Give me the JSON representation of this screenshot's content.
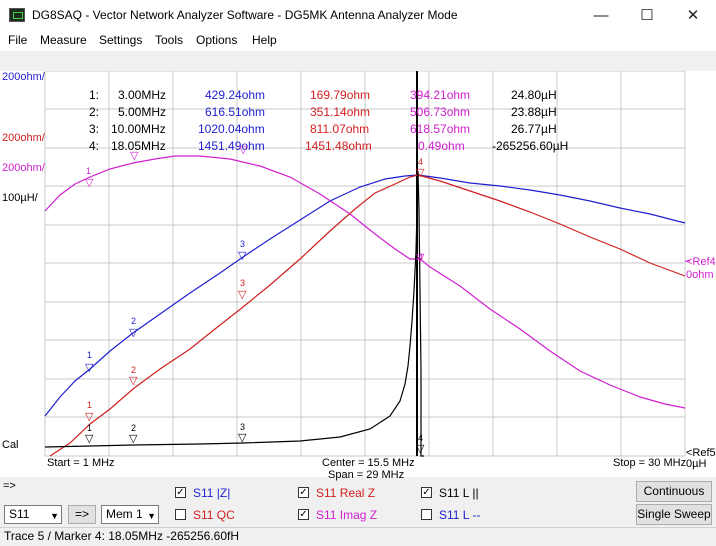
{
  "window": {
    "title": "DG8SAQ  -  Vector Network Analyzer Software - DG5MK Antenna Analyzer Mode",
    "minimize": "—",
    "maximize": "☐",
    "close": "✕"
  },
  "menu": [
    "File",
    "Measure",
    "Settings",
    "Tools",
    "Options",
    "Help"
  ],
  "plot": {
    "scale_labels": [
      "200ohm/",
      "200ohm/",
      "200ohm/",
      "100µH/"
    ],
    "cal_label": "Cal",
    "ref_right_top": "<Ref4",
    "ref_right_top2": "0ohm",
    "ref_right_bottom": "<Ref5",
    "ref_right_bottom2": "0µH",
    "start": "Start = 1 MHz",
    "center": "Center = 15.5 MHz",
    "span": "Span = 29 MHz",
    "stop": "Stop = 30 MHz",
    "markers": [
      {
        "n": "1:",
        "f": "3.00MHz",
        "z": "429.24ohm",
        "r": "169.79ohm",
        "x": "394.21ohm",
        "l": "24.80µH"
      },
      {
        "n": "2:",
        "f": "5.00MHz",
        "z": "616.51ohm",
        "r": "351.14ohm",
        "x": "506.73ohm",
        "l": "23.88µH"
      },
      {
        "n": "3:",
        "f": "10.00MHz",
        "z": "1020.04ohm",
        "r": "811.07ohm",
        "x": "618.57ohm",
        "l": "26.77µH"
      },
      {
        "n": "4:",
        "f": "18.05MHz",
        "z": "1451.49ohm",
        "r": "1451.48ohm",
        "x": "0.49ohm",
        "l": "-265256.60µH"
      }
    ],
    "marker_ids": [
      "1",
      "2",
      "3",
      "4"
    ]
  },
  "colors": {
    "z": "#1f1fd0",
    "r": "#d01f1f",
    "x": "#d01fd0",
    "l": "#000000"
  },
  "panel": {
    "arrow_label": "=>",
    "traces": [
      {
        "label": "S11  |Z|",
        "checked": "✓",
        "color": "#1f1fd0"
      },
      {
        "label": "S11  QC",
        "checked": "",
        "color": "#d01f1f"
      },
      {
        "label": "S11  Real Z",
        "checked": "✓",
        "color": "#d01f1f"
      },
      {
        "label": "S11  Imag Z",
        "checked": "✓",
        "color": "#d01fd0"
      },
      {
        "label": "S11  L ||",
        "checked": "✓",
        "color": "#000000"
      },
      {
        "label": "S11  L --",
        "checked": "",
        "color": "#1f1fd0"
      }
    ],
    "param_select": "S11",
    "arrow_btn": "=>",
    "mem_select": "Mem 1",
    "continuous": "Continuous",
    "single_sweep": "Single Sweep"
  },
  "status": "Trace 5 / Marker 4:  18.05MHz  -265256.60fH"
}
